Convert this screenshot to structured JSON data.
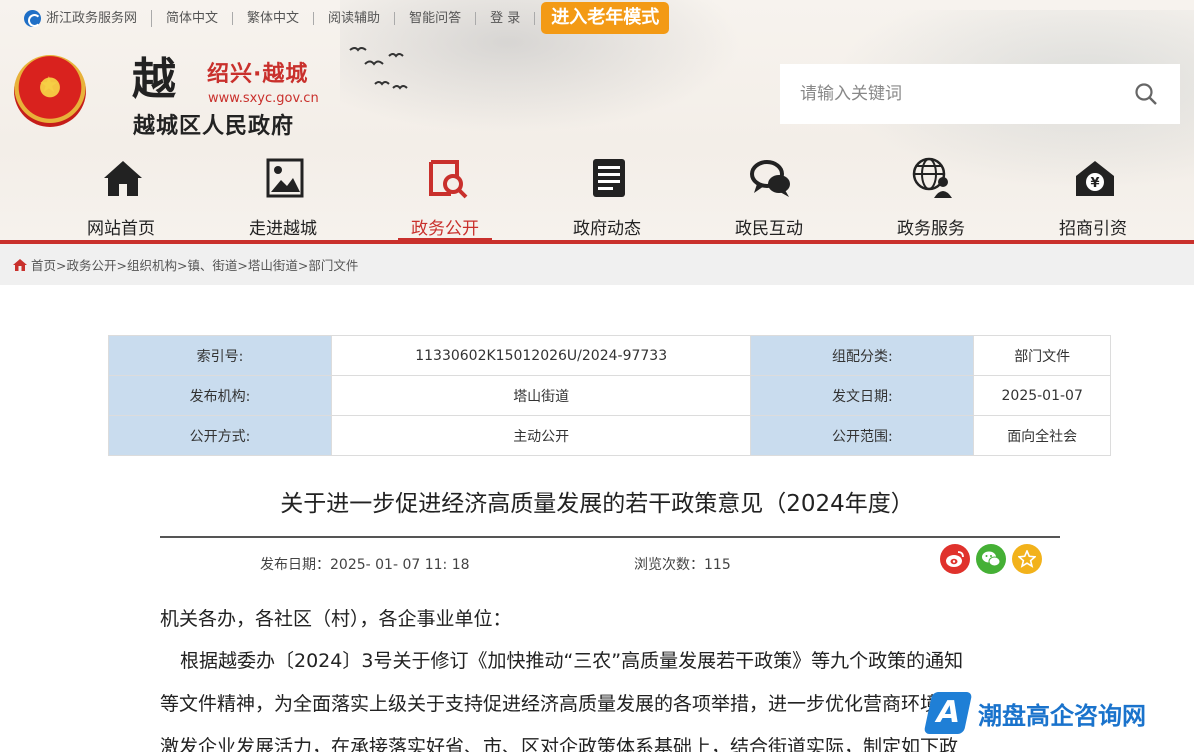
{
  "topbar": {
    "portal": "浙江政务服务网",
    "simplified": "简体中文",
    "traditional": "繁体中文",
    "reading": "阅读辅助",
    "qa": "智能问答",
    "login": "登 录",
    "elder_mode": "进入老年模式"
  },
  "logo": {
    "char": "越",
    "city": "绍兴·越城",
    "url": "www.sxyc.gov.cn",
    "name": "越城区人民政府"
  },
  "search": {
    "placeholder": "请输入关键词"
  },
  "nav": [
    {
      "label": "网站首页",
      "icon": "home-icon"
    },
    {
      "label": "走进越城",
      "icon": "picture-icon"
    },
    {
      "label": "政务公开",
      "icon": "document-search-icon",
      "active": true
    },
    {
      "label": "政府动态",
      "icon": "news-icon"
    },
    {
      "label": "政民互动",
      "icon": "chat-icon"
    },
    {
      "label": "政务服务",
      "icon": "globe-person-icon"
    },
    {
      "label": "招商引资",
      "icon": "house-yen-icon"
    }
  ],
  "breadcrumb": "首页>政务公开>组织机构>镇、街道>塔山街道>部门文件",
  "meta": {
    "index_label": "索引号:",
    "index_value": "11330602K15012026U/2024-97733",
    "category_label": "组配分类:",
    "category_value": "部门文件",
    "org_label": "发布机构:",
    "org_value": "塔山街道",
    "date_label": "发文日期:",
    "date_value": "2025-01-07",
    "mode_label": "公开方式:",
    "mode_value": "主动公开",
    "scope_label": "公开范围:",
    "scope_value": "面向全社会"
  },
  "article": {
    "title": "关于进一步促进经济高质量发展的若干政策意见（2024年度）",
    "publish_label": "发布日期：",
    "publish_value": "2025- 01- 07 11: 18",
    "views_label": "浏览次数：",
    "views_value": "115",
    "salutation": "机关各办，各社区（村），各企事业单位：",
    "line1": "根据越委办〔2024〕3号关于修订《加快推动“三农”高质量发展若干政策》等九个政策的通知",
    "line2": "等文件精神，为全面落实上级关于支持促进经济高质量发展的各项举措，进一步优化营商环境，",
    "line3": "激发企业发展活力，在承接落实好省、市、区对企政策体系基础上，结合街道实际，制定如下政"
  },
  "share": [
    "weibo-icon",
    "wechat-icon",
    "favorite-icon"
  ],
  "watermark": {
    "logo": "A",
    "text": "潮盘高企咨询网"
  },
  "colors": {
    "accent": "#c9302c",
    "table_key_bg": "#c9dcee",
    "elder_btn": "#f39a15"
  }
}
